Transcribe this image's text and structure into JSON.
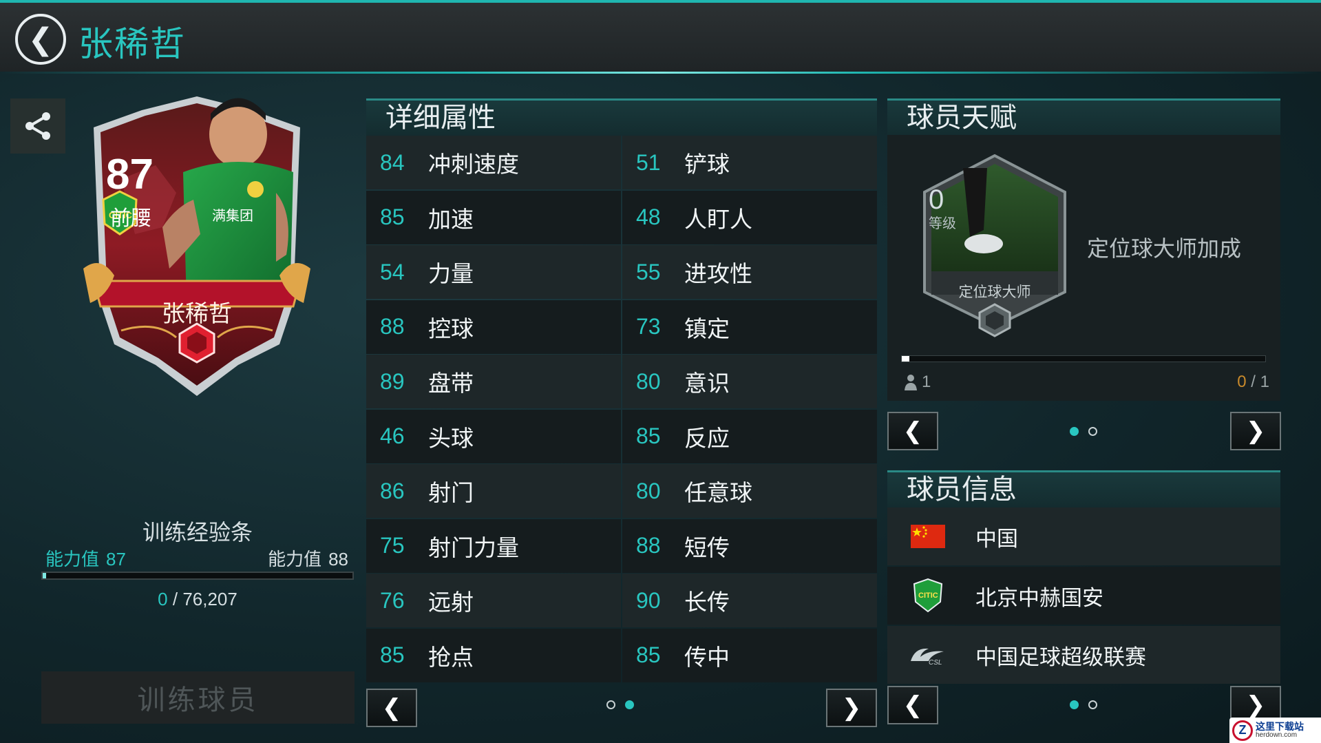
{
  "header": {
    "title": "张稀哲",
    "back_icon": "chevron-left-icon"
  },
  "card": {
    "rating": "87",
    "position": "前腰",
    "name": "张稀哲",
    "club_badge": "beijing-guoan-badge",
    "colors": {
      "frame": "#b3122a",
      "accent": "#e0a64a"
    }
  },
  "training": {
    "title": "训练经验条",
    "left_label": "能力值",
    "left_value": "87",
    "right_label": "能力值",
    "right_value": "88",
    "current": "0",
    "separator": "/",
    "total": "76,207",
    "progress_fraction": 0,
    "button_label": "训练球员"
  },
  "attributes": {
    "title": "详细属性",
    "rows": [
      [
        {
          "value": "84",
          "name": "冲刺速度"
        },
        {
          "value": "51",
          "name": "铲球"
        }
      ],
      [
        {
          "value": "85",
          "name": "加速"
        },
        {
          "value": "48",
          "name": "人盯人"
        }
      ],
      [
        {
          "value": "54",
          "name": "力量"
        },
        {
          "value": "55",
          "name": "进攻性"
        }
      ],
      [
        {
          "value": "88",
          "name": "控球"
        },
        {
          "value": "73",
          "name": "镇定"
        }
      ],
      [
        {
          "value": "89",
          "name": "盘带"
        },
        {
          "value": "80",
          "name": "意识"
        }
      ],
      [
        {
          "value": "46",
          "name": "头球"
        },
        {
          "value": "85",
          "name": "反应"
        }
      ],
      [
        {
          "value": "86",
          "name": "射门"
        },
        {
          "value": "80",
          "name": "任意球"
        }
      ],
      [
        {
          "value": "75",
          "name": "射门力量"
        },
        {
          "value": "88",
          "name": "短传"
        }
      ],
      [
        {
          "value": "76",
          "name": "远射"
        },
        {
          "value": "90",
          "name": "长传"
        }
      ],
      [
        {
          "value": "85",
          "name": "抢点"
        },
        {
          "value": "85",
          "name": "传中"
        }
      ]
    ],
    "page": 2,
    "page_count": 2
  },
  "talent": {
    "title": "球员天赋",
    "level_value": "0",
    "level_label": "等级",
    "skill_name": "定位球大师",
    "description": "定位球大师加成",
    "people_count": "1",
    "progress_current": "0",
    "progress_separator": "/",
    "progress_total": "1",
    "page": 1,
    "page_count": 2
  },
  "player_info": {
    "title": "球员信息",
    "nation": "中国",
    "club": "北京中赫国安",
    "league": "中国足球超级联赛",
    "page": 1,
    "page_count": 2
  },
  "watermark": {
    "title": "这里下载站",
    "url": "herdown.com"
  }
}
